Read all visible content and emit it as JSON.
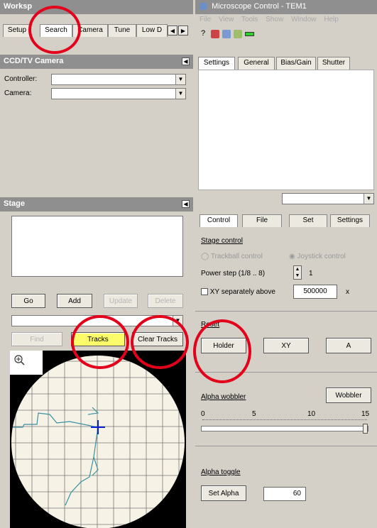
{
  "workspace": {
    "title": "Worksp",
    "tabs": [
      "Setup",
      "Search",
      "Camera",
      "Tune",
      "Low D"
    ],
    "scroll_left": "◀",
    "scroll_right": "▶"
  },
  "microscope": {
    "title": "Microscope Control - TEM1",
    "menu": [
      "File",
      "View",
      "Tools",
      "Show",
      "Window",
      "Help"
    ],
    "tabs": [
      "Settings",
      "General",
      "Bias/Gain",
      "Shutter"
    ]
  },
  "ccd": {
    "title": "CCD/TV Camera",
    "controller_label": "Controller:",
    "camera_label": "Camera:"
  },
  "stage": {
    "title": "Stage",
    "go": "Go",
    "add": "Add",
    "update": "Update",
    "delete": "Delete",
    "find": "Find",
    "tracks": "Tracks",
    "clear_tracks": "Clear Tracks"
  },
  "control": {
    "tabs": [
      "Control",
      "File",
      "Set",
      "Settings"
    ],
    "stage_control_label": "Stage control",
    "trackball": "Trackball control",
    "joystick": "Joystick control",
    "power_step_label": "Power step (1/8 .. 8)",
    "power_step_value": "1",
    "xy_separately_label": "XY separately above",
    "xy_value": "500000",
    "xy_unit": "x",
    "reset_label": "Reset",
    "holder": "Holder",
    "xy": "XY",
    "a": "A",
    "alpha_wobbler_label": "Alpha wobbler",
    "wobbler_button": "Wobbler",
    "slider_ticks": [
      "0",
      "5",
      "10",
      "15"
    ],
    "slider_value": 15,
    "slider_max": 15,
    "alpha_toggle_label": "Alpha toggle",
    "set_alpha": "Set Alpha",
    "alpha_value": "60"
  },
  "colors": {
    "highlight_yellow": "#fcfc6a",
    "annotation_red": "#e3001b",
    "track_line": "#3a8fa0",
    "cursor_blue": "#0a1fd4"
  }
}
